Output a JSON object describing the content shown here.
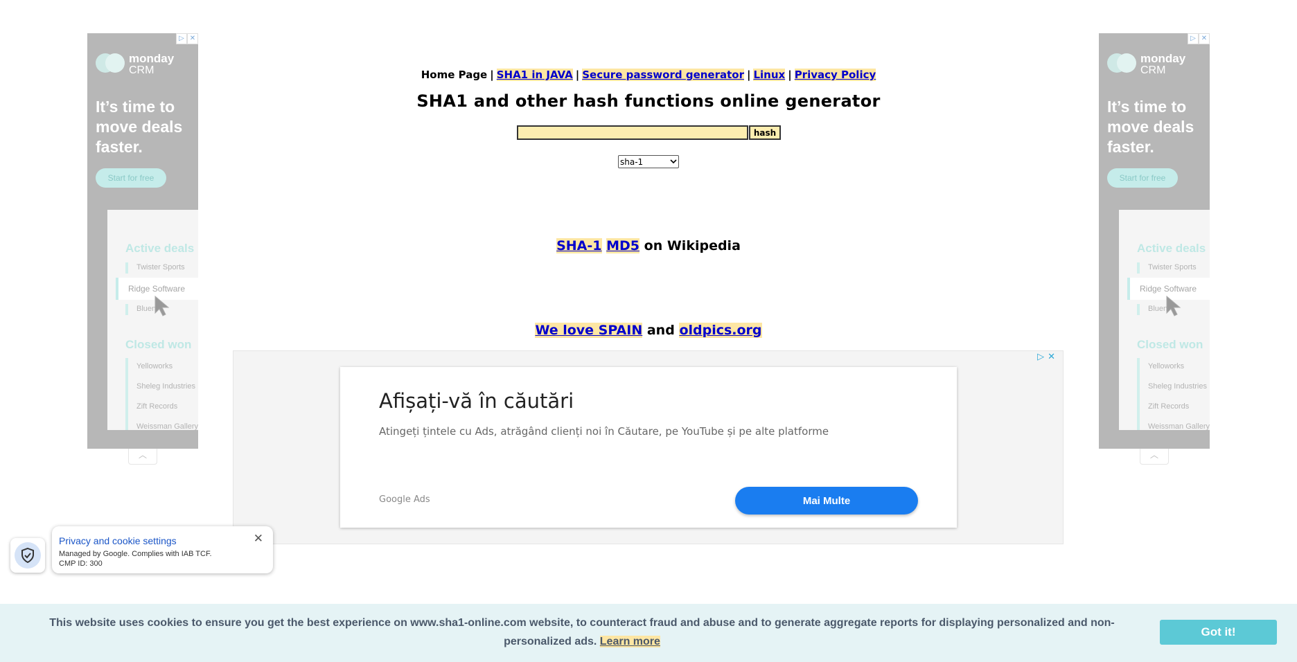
{
  "nav": {
    "home": "Home Page",
    "separator": "|",
    "links": [
      "SHA1 in JAVA",
      "Secure password generator",
      "Linux",
      "Privacy Policy"
    ]
  },
  "title": "SHA1 and other hash functions online generator",
  "form": {
    "input_value": "",
    "button_label": "hash",
    "algorithm_selected": "sha-1"
  },
  "wiki": {
    "link1": "SHA-1",
    "link2": "MD5",
    "suffix": "on Wikipedia"
  },
  "love": {
    "link1": "We love SPAIN",
    "and": "and",
    "link2": "oldpics.org"
  },
  "side_ad": {
    "brand": "monday",
    "brand_sub": "CRM",
    "headline": "It’s time to move deals faster.",
    "cta": "Start for free",
    "section1": "Active deals",
    "items1": [
      "Twister Sports",
      "Ridge Software",
      "Bluen"
    ],
    "section2": "Closed won",
    "items2": [
      "Yelloworks",
      "Sheleg Industries",
      "Zift Records",
      "Weissman Gallery"
    ],
    "adchoices": [
      "▷",
      "✕"
    ],
    "collapse": "︿"
  },
  "center_ad": {
    "heading": "Afișați-vă în căutări",
    "text": "Atingeți țintele cu Ads, atrăgând clienți noi în Căutare, pe YouTube și pe alte platforme",
    "brand": "Google Ads",
    "button": "Mai Multe",
    "adchoices": "▷✕"
  },
  "privacy": {
    "title": "Privacy and cookie settings",
    "line1": "Managed by Google. Complies with IAB TCF.",
    "line2": "CMP ID: 300",
    "close": "✕"
  },
  "cookie": {
    "message": "This website uses cookies to ensure you get the best experience on www.sha1-online.com website, to counteract fraud and abuse and to generate aggregate reports for displaying personalized and non-personalized ads.",
    "learn_more": "Learn more",
    "button": "Got it!"
  },
  "colors": {
    "highlight": "#fde6a3",
    "link": "#0000cc",
    "cookie_bg": "#e5f3f5",
    "got_button": "#5cc9d6",
    "ad_button": "#1a7df0"
  }
}
